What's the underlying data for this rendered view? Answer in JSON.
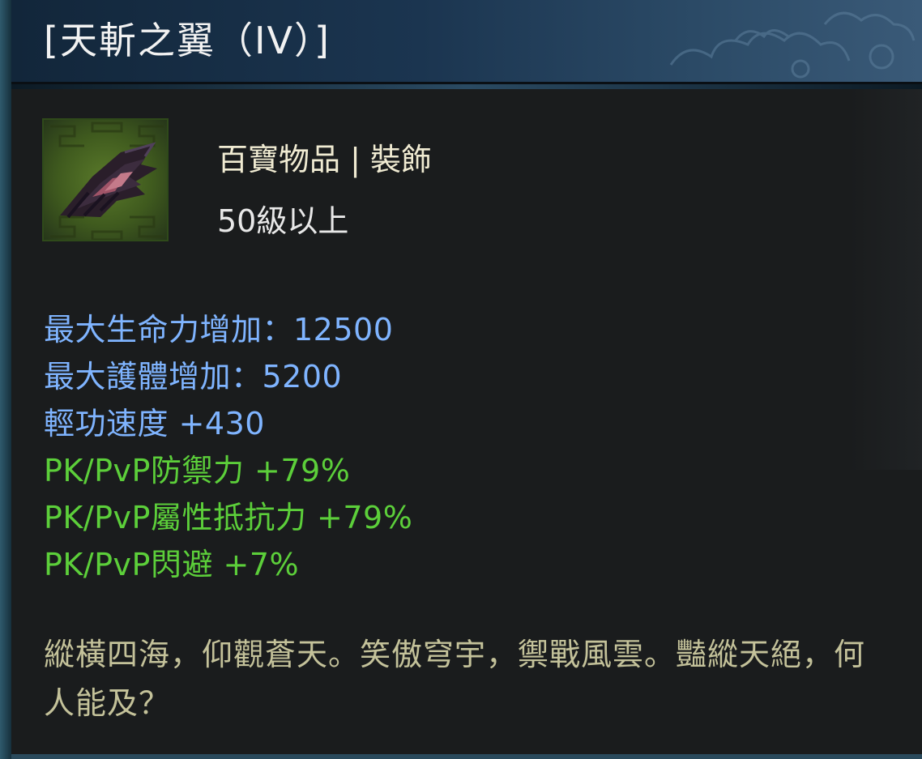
{
  "tooltip": {
    "title": "[天斬之翼（IV）]",
    "item_type": "百寶物品 | 裝飾",
    "level_requirement": "50級以上",
    "stats": [
      {
        "text": "最大生命力增加：12500",
        "color": "#7fb4ff"
      },
      {
        "text": "最大護體增加：5200",
        "color": "#7fb4ff"
      },
      {
        "text": "輕功速度 +430",
        "color": "#7fb4ff"
      },
      {
        "text": "PK/PvP防禦力 +79%",
        "color": "#5ccf3a"
      },
      {
        "text": "PK/PvP屬性抵抗力 +79%",
        "color": "#5ccf3a"
      },
      {
        "text": "PK/PvP閃避 +7%",
        "color": "#5ccf3a"
      }
    ],
    "description": "縱橫四海，仰觀蒼天。笑傲穹宇，禦戰風雲。豔縱天絕，何人能及？",
    "icon": "wing-icon"
  },
  "colors": {
    "title_text": "#f2f2f2",
    "stat_blue": "#7fb4ff",
    "stat_green": "#5ccf3a",
    "description": "#c4c29a",
    "background": "#1a1c1d"
  }
}
